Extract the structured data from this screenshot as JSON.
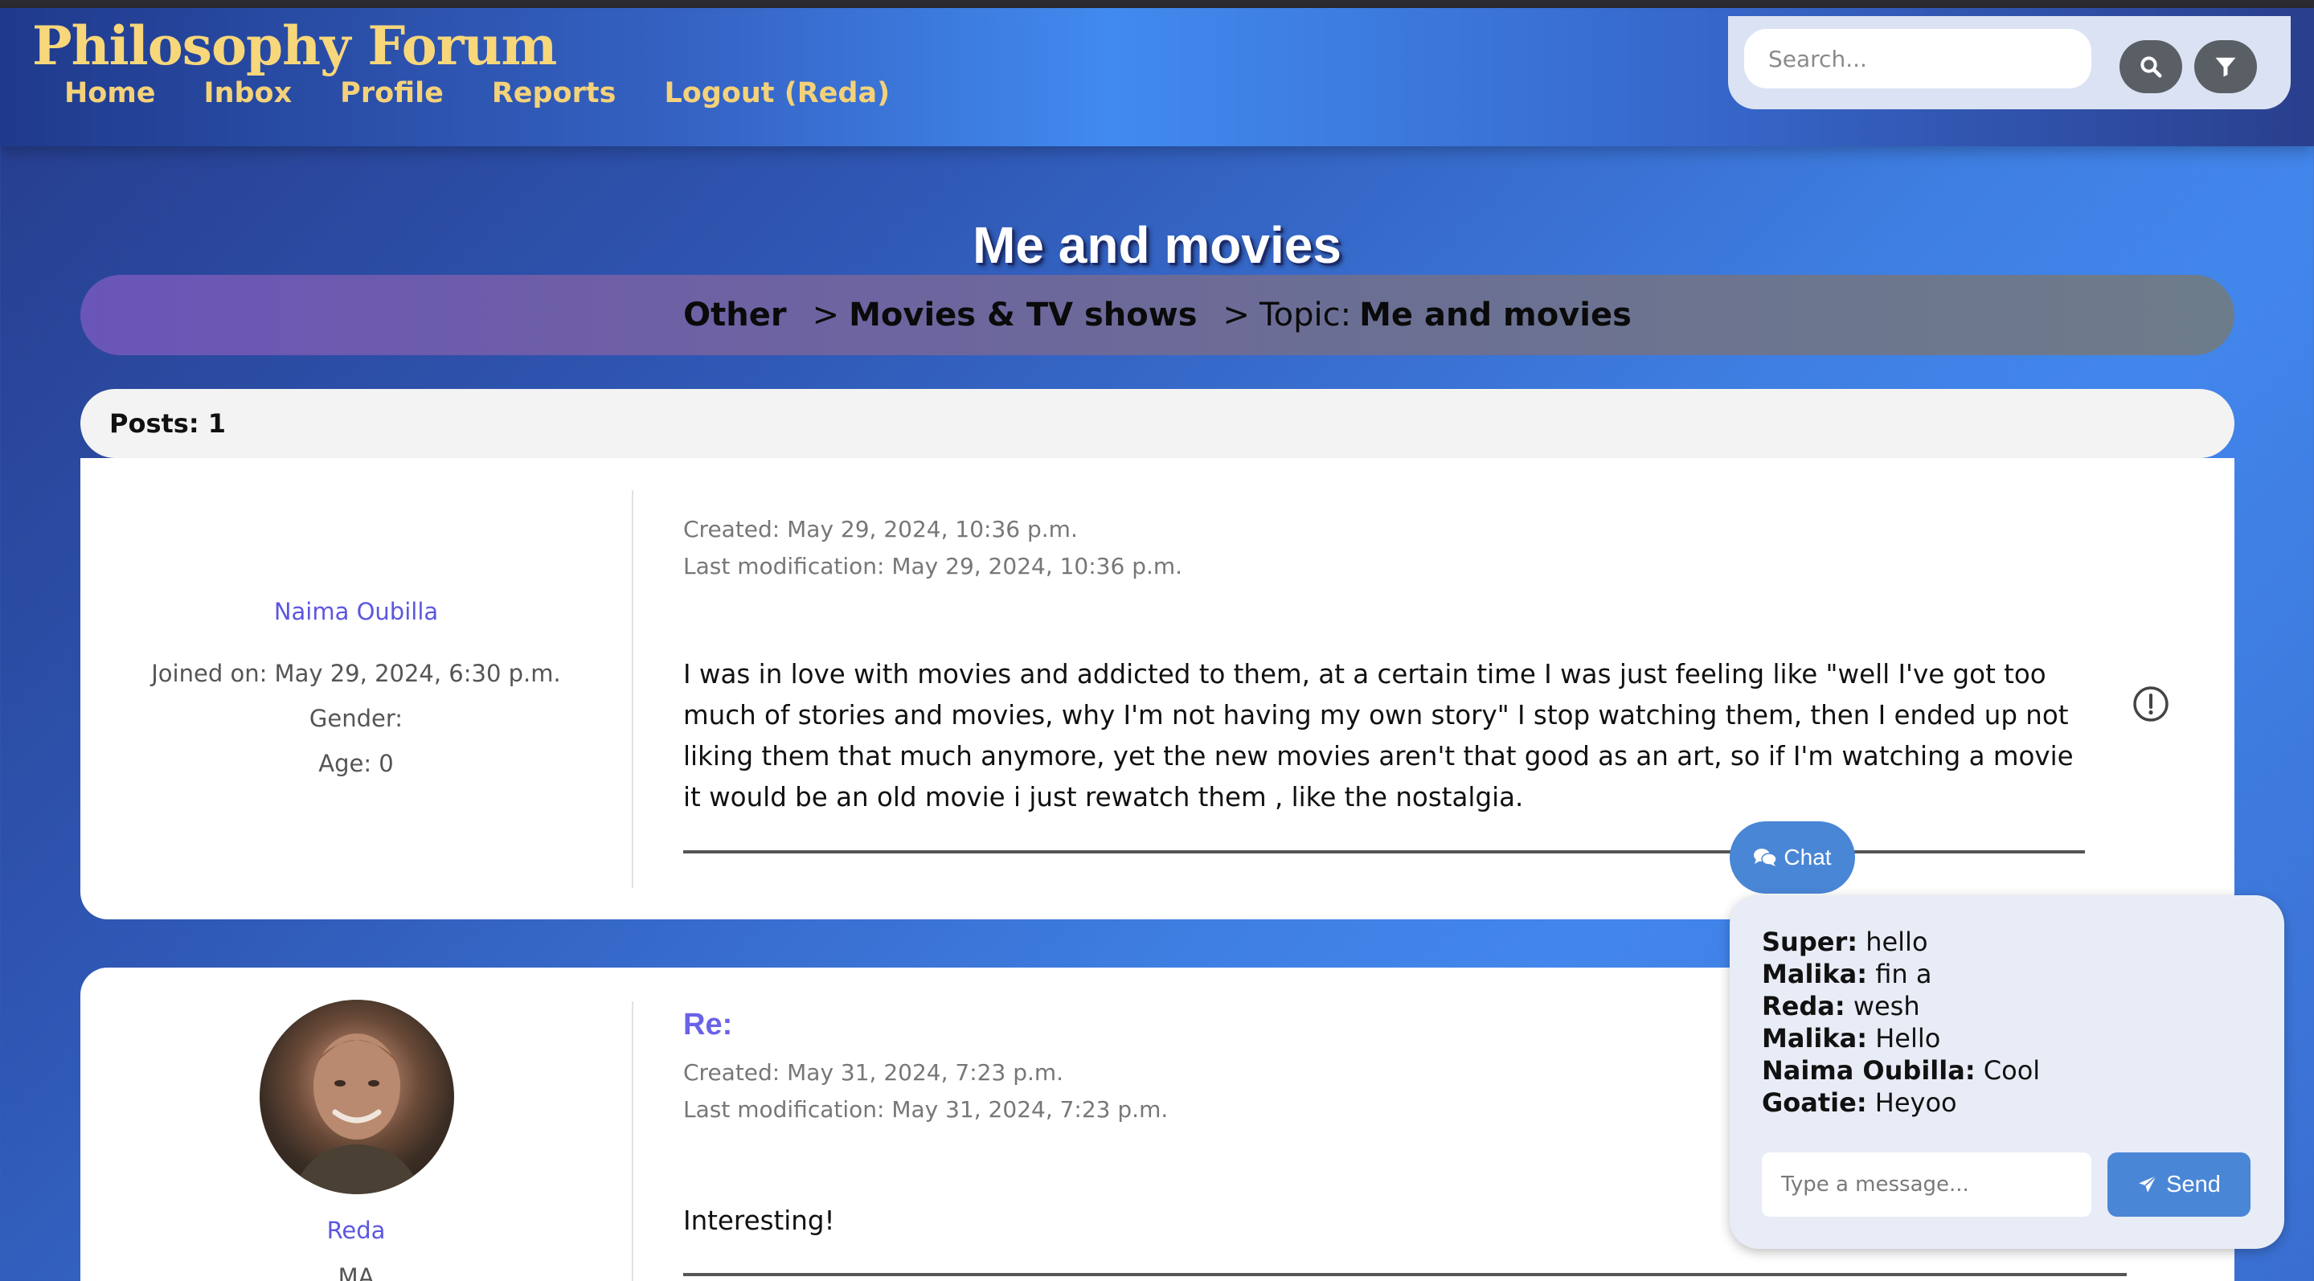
{
  "nav": {
    "brand": "Philosophy Forum",
    "links": [
      "Home",
      "Inbox",
      "Profile",
      "Reports",
      "Logout (Reda)"
    ],
    "search_placeholder": "Search...",
    "colors": {
      "brand": "#f7d77a",
      "link": "#f4d27a"
    }
  },
  "topic": {
    "title": "Me and movies",
    "breadcrumb": {
      "category": "Other",
      "sep1": ">",
      "subcategory": "Movies & TV shows",
      "sep2": ">",
      "topic_prefix": "Topic:",
      "topic_name": "Me and movies"
    }
  },
  "posts_count": "Posts: 1",
  "posts": [
    {
      "author": "Naima Oubilla",
      "joined": "Joined on: May 29, 2024, 6:30 p.m.",
      "gender": "Gender:",
      "age": "Age: 0",
      "created": "Created: May 29, 2024, 10:36 p.m.",
      "modified": "Last modification: May 29, 2024, 10:36 p.m.",
      "body": "I was in love with movies and addicted to them, at a certain time I was just feeling like \"well I've got too much of stories and movies, why I'm not having my own story\" I stop watching them, then I ended up not liking them that much anymore, yet the new movies aren't that good as an art, so if I'm watching a movie it would be an old movie i just rewatch them , like the nostalgia."
    },
    {
      "author": "Reda",
      "role": "MA",
      "title": "Re:",
      "created": "Created: May 31, 2024, 7:23 p.m.",
      "modified": "Last modification: May 31, 2024, 7:23 p.m.",
      "body": "Interesting!"
    }
  ],
  "chat": {
    "toggle_label": "Chat",
    "messages": [
      {
        "user": "Super:",
        "text": "hello"
      },
      {
        "user": "Malika:",
        "text": "fin a"
      },
      {
        "user": "Reda:",
        "text": "wesh"
      },
      {
        "user": "Malika:",
        "text": "Hello"
      },
      {
        "user": "Naima Oubilla:",
        "text": "Cool"
      },
      {
        "user": "Goatie:",
        "text": "Heyoo"
      }
    ],
    "input_placeholder": "Type a message...",
    "send_label": "Send"
  }
}
